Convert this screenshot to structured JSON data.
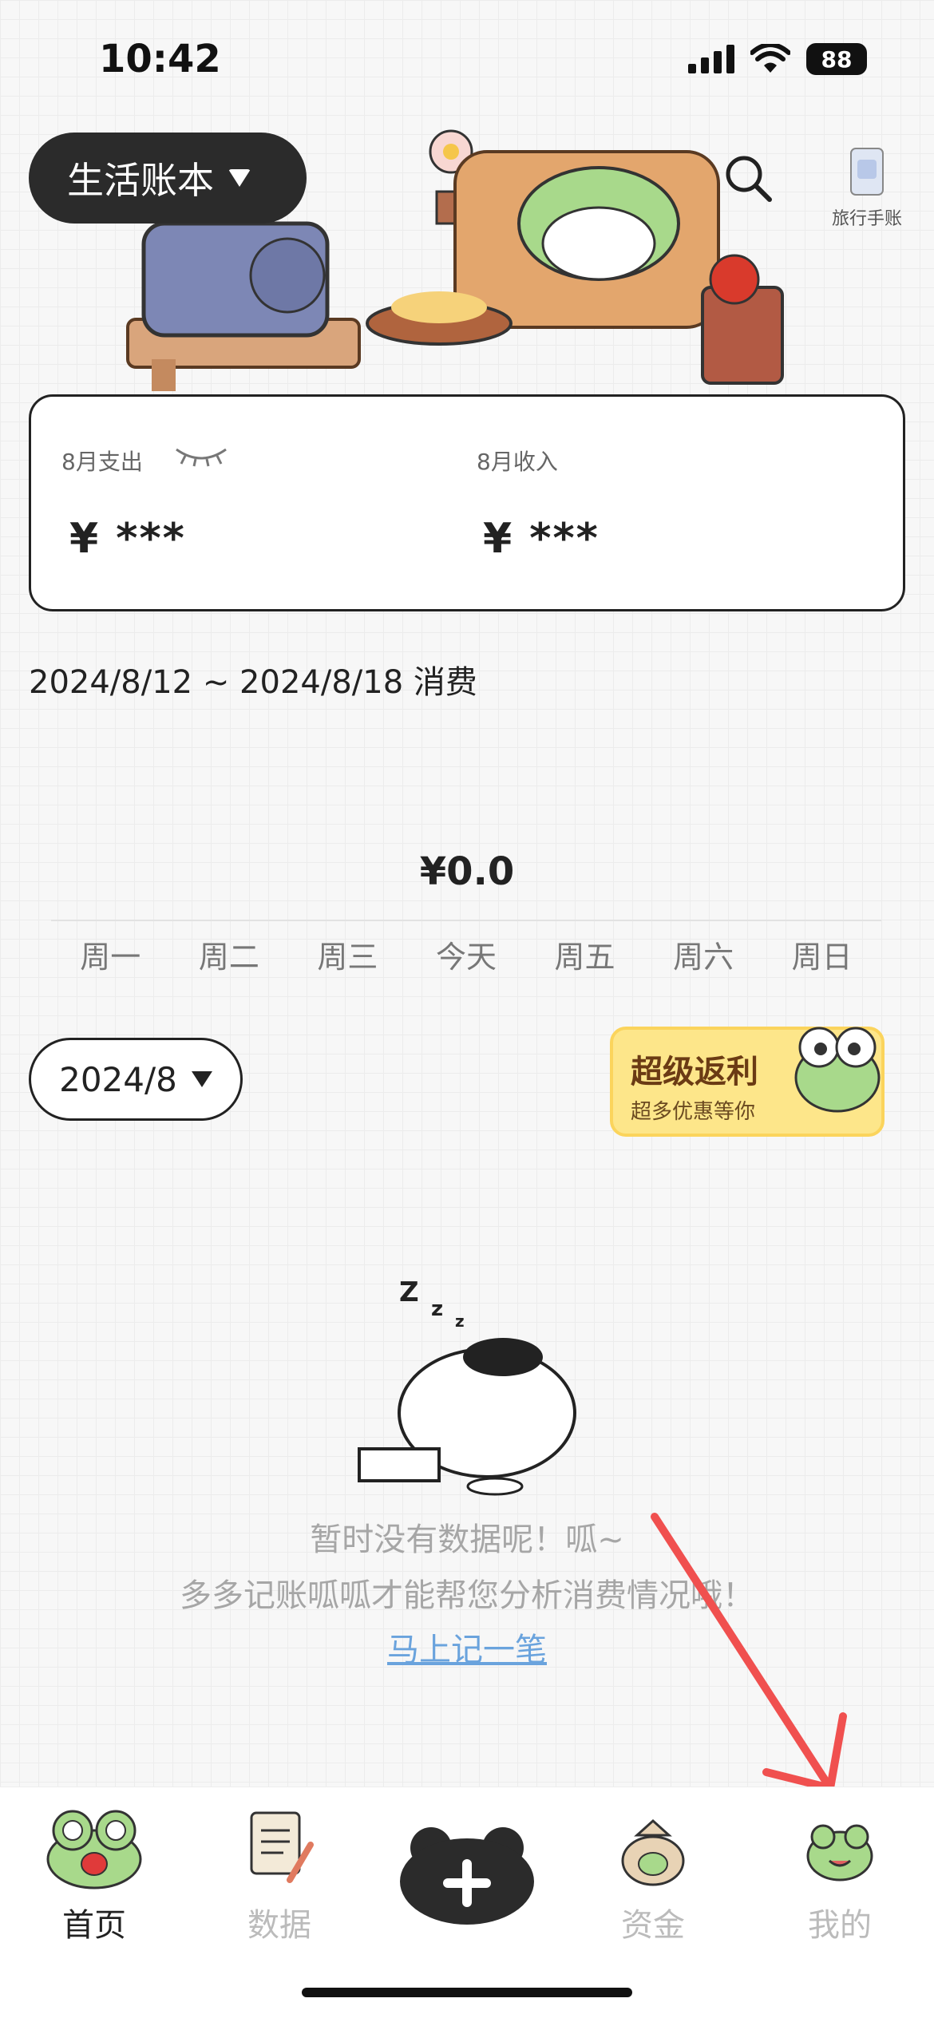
{
  "status": {
    "time": "10:42",
    "battery": "88"
  },
  "header": {
    "book_name": "生活账本",
    "travel_label": "旅行手账"
  },
  "summary": {
    "expense_label": "8月支出",
    "expense_value": "¥ ***",
    "income_label": "8月收入",
    "income_value": "¥ ***"
  },
  "week": {
    "title": "2024/8/12 ~ 2024/8/18 消费",
    "total": "¥0.0",
    "days": [
      "周一",
      "周二",
      "周三",
      "今天",
      "周五",
      "周六",
      "周日"
    ]
  },
  "month_selector": {
    "value": "2024/8"
  },
  "promo": {
    "title": "超级返利",
    "subtitle": "超多优惠等你"
  },
  "empty_state": {
    "line1": "暂时没有数据呢！呱~",
    "line2": "多多记账呱呱才能帮您分析消费情况哦！",
    "link": "马上记一笔"
  },
  "tabs": [
    {
      "label": "首页",
      "active": true
    },
    {
      "label": "数据",
      "active": false
    },
    {
      "label": "资金",
      "active": false
    },
    {
      "label": "我的",
      "active": false
    }
  ],
  "colors": {
    "accent_dark": "#2b2b2b",
    "link": "#6aa3dd",
    "promo_bg": "#fde68a",
    "annotation": "#f0504f"
  }
}
